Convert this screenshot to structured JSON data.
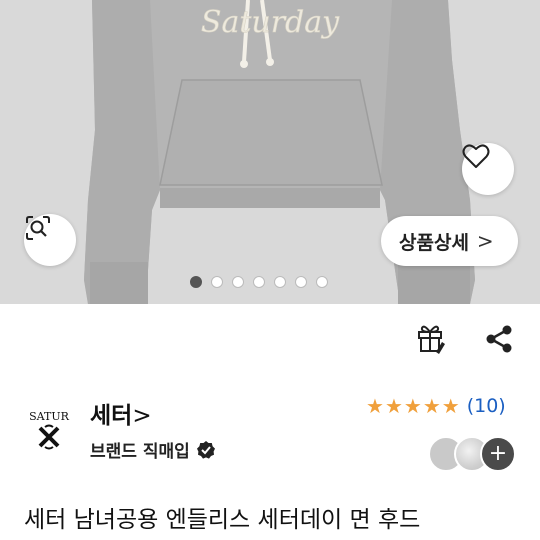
{
  "product": {
    "hero_text": "Saturday",
    "detail_button_label": "상품상세",
    "detail_button_chevron": ">",
    "carousel": {
      "total": 7,
      "active_index": 0
    },
    "title": "세터 남녀공용 엔들리스 세터데이 면 후드"
  },
  "seller": {
    "logo_text_top": "SATUR",
    "logo_text_bottom": "X",
    "name": "세터",
    "name_chevron": ">",
    "type": "브랜드 직매입",
    "rating": {
      "stars": 5,
      "count_label": "(10)"
    },
    "reviewer_more": "+"
  },
  "icons": {
    "heart": "heart-icon",
    "zoom": "image-search-icon",
    "gift": "gift-icon",
    "share": "share-icon",
    "verified": "verified-check-icon"
  },
  "colors": {
    "hoodie": "#b3b3b3",
    "background": "#d9d9d9",
    "star": "#f0a03c",
    "rating_count": "#1b5fc2"
  }
}
